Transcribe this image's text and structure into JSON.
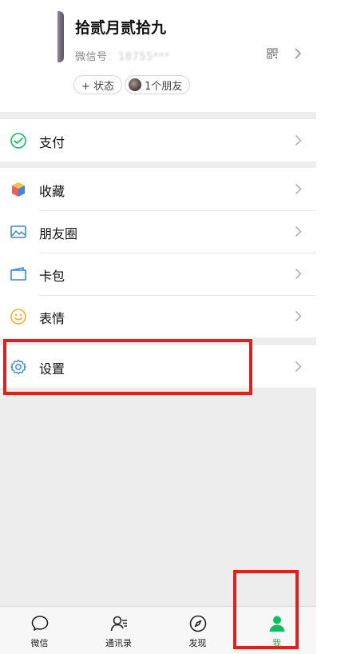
{
  "profile": {
    "nickname": "拾贰月贰拾九",
    "wechat_id_prefix": "微信号",
    "wechat_id_blurred": "：18755***",
    "status_label": "+ 状态",
    "friends_label": "1个朋友"
  },
  "menu": {
    "pay": {
      "label": "支付",
      "icon": "pay-icon"
    },
    "favorites": {
      "label": "收藏",
      "icon": "cube-icon"
    },
    "moments": {
      "label": "朋友圈",
      "icon": "image-icon"
    },
    "cards": {
      "label": "卡包",
      "icon": "card-icon"
    },
    "stickers": {
      "label": "表情",
      "icon": "smile-icon"
    },
    "settings": {
      "label": "设置",
      "icon": "gear-icon"
    }
  },
  "tabbar": {
    "tabs": [
      {
        "label": "微信",
        "icon": "chat-bubble-icon"
      },
      {
        "label": "通讯录",
        "icon": "contacts-icon"
      },
      {
        "label": "发现",
        "icon": "compass-icon"
      },
      {
        "label": "我",
        "icon": "person-icon",
        "active": true
      }
    ]
  },
  "colors": {
    "accent_green": "#07c160",
    "annotation_red": "#e02020",
    "background": "#ededed"
  }
}
